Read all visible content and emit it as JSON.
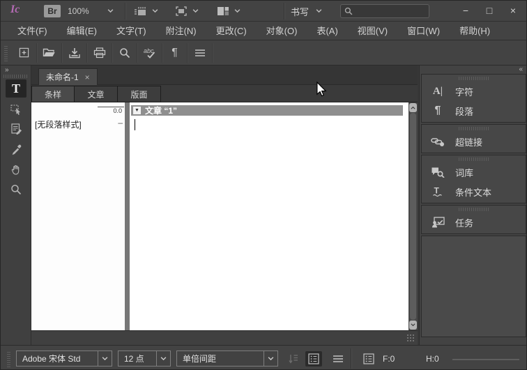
{
  "titlebar": {
    "logo": "Ic",
    "bridge_label": "Br",
    "zoom_level": "100%",
    "workspace_name": "书写",
    "search_value": "",
    "window": {
      "minimize": "−",
      "maximize": "□",
      "close": "×"
    }
  },
  "menubar": {
    "items": [
      {
        "label": "文件(F)"
      },
      {
        "label": "编辑(E)"
      },
      {
        "label": "文字(T)"
      },
      {
        "label": "附注(N)"
      },
      {
        "label": "更改(C)"
      },
      {
        "label": "对象(O)"
      },
      {
        "label": "表(A)"
      },
      {
        "label": "视图(V)"
      },
      {
        "label": "窗口(W)"
      },
      {
        "label": "帮助(H)"
      }
    ]
  },
  "icons": {
    "pilcrow": "¶",
    "character": "A|",
    "type_tool": "T",
    "story_collapse": "▼",
    "tools_expand": "»",
    "dock_collapse": "«",
    "tab_close": "×"
  },
  "document": {
    "tab_title": "未命名-1",
    "view_tabs": [
      {
        "label": "条样",
        "active": true
      },
      {
        "label": "文章",
        "active": false
      },
      {
        "label": "版面",
        "active": false
      }
    ],
    "galley": {
      "ruler_value": "0.0",
      "paragraph_style": "[无段落样式]",
      "style_tick": "–",
      "story_header": "文章 “1”"
    }
  },
  "right_dock": {
    "groups": [
      {
        "items": [
          {
            "icon": "character-icon",
            "label": "字符"
          },
          {
            "icon": "paragraph-icon",
            "label": "段落"
          }
        ]
      },
      {
        "items": [
          {
            "icon": "hyperlinks-icon",
            "label": "超链接"
          }
        ]
      },
      {
        "items": [
          {
            "icon": "thesaurus-icon",
            "label": "词库"
          },
          {
            "icon": "conditional-text-icon",
            "label": "条件文本"
          }
        ]
      },
      {
        "items": [
          {
            "icon": "assignments-icon",
            "label": "任务"
          }
        ]
      }
    ]
  },
  "bottombar": {
    "font_name": "Adobe 宋体 Std",
    "font_size": "12 点",
    "leading": "单倍间距",
    "copyfit": {
      "f": "F:0",
      "h": "H:0"
    }
  },
  "colors": {
    "ui_bg": "#434343",
    "paper": "#ffffff",
    "story_header_bg": "#8f8f8f",
    "accent_logo": "#b56bb5",
    "text_light": "#d6d6d6"
  }
}
